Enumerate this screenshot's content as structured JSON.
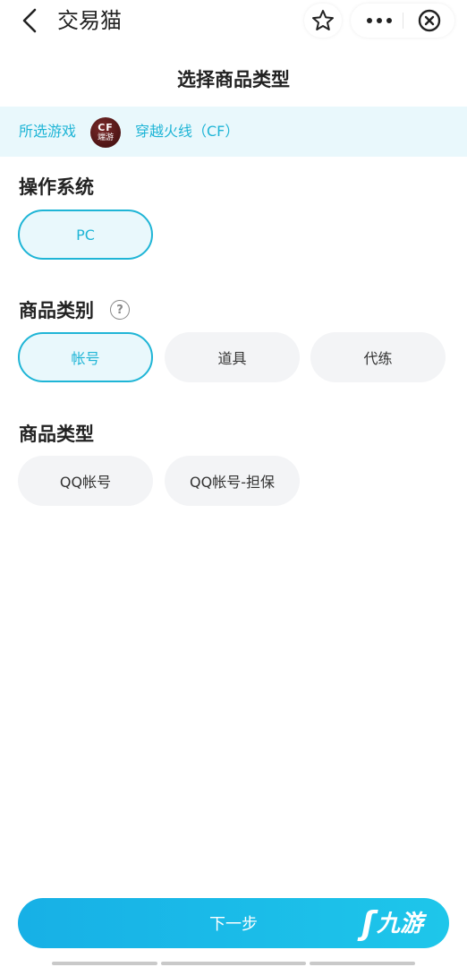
{
  "nav": {
    "app_title": "交易猫",
    "back_icon": "chevron-left-icon",
    "favorite_icon": "star-icon",
    "more_icon": "ellipsis-icon",
    "close_icon": "close-circle-icon"
  },
  "page_title": "选择商品类型",
  "selected_game": {
    "label": "所选游戏",
    "logo_text_top": "CF",
    "logo_text_bottom": "端游",
    "name": "穿越火线（CF）"
  },
  "os_section": {
    "title": "操作系统",
    "options": [
      {
        "label": "PC",
        "selected": true
      }
    ]
  },
  "category_section": {
    "title": "商品类别",
    "help_icon": "question-circle-icon",
    "help_glyph": "?",
    "options": [
      {
        "label": "帐号",
        "selected": true
      },
      {
        "label": "道具",
        "selected": false
      },
      {
        "label": "代练",
        "selected": false
      }
    ]
  },
  "type_section": {
    "title": "商品类型",
    "options": [
      {
        "label": "QQ帐号",
        "selected": false
      },
      {
        "label": "QQ帐号-担保",
        "selected": false
      }
    ]
  },
  "next_button": {
    "label": "下一步"
  },
  "watermark": {
    "mark": "ʃ",
    "text": "九游"
  },
  "colors": {
    "accent": "#1fb5d6",
    "chip_bg": "#f3f4f6",
    "selected_bg": "#e9f8fc"
  }
}
